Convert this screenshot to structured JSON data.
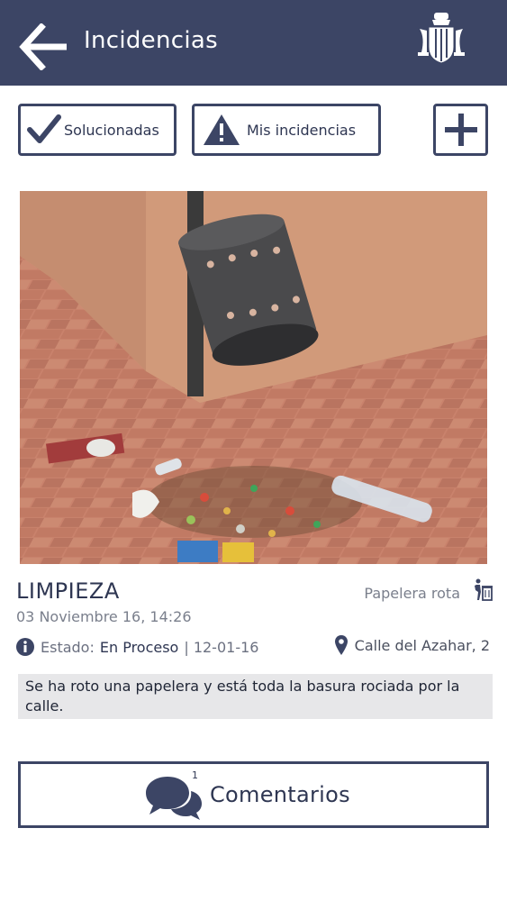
{
  "header": {
    "title": "Incidencias",
    "back_icon": "arrow-left-icon",
    "logo": "coat-of-arms-logo"
  },
  "toolbar": {
    "solved_label": "Solucionadas",
    "mine_label": "Mis incidencias",
    "add_icon": "plus-icon"
  },
  "incident": {
    "category": "LIMPIEZA",
    "subtype": "Papelera rota",
    "date": "03 Noviembre 16, 14:26",
    "status_prefix": "Estado:",
    "status_value": "En Proceso",
    "status_date": "| 12-01-16",
    "location": "Calle del Azahar, 2",
    "description": "Se ha roto una papelera y está toda la basura rociada por la calle."
  },
  "comments": {
    "label": "Comentarios",
    "count": "1"
  },
  "colors": {
    "header_bg": "#3c4565",
    "accent": "#3c4565",
    "description_bg": "#e7e7e9"
  }
}
